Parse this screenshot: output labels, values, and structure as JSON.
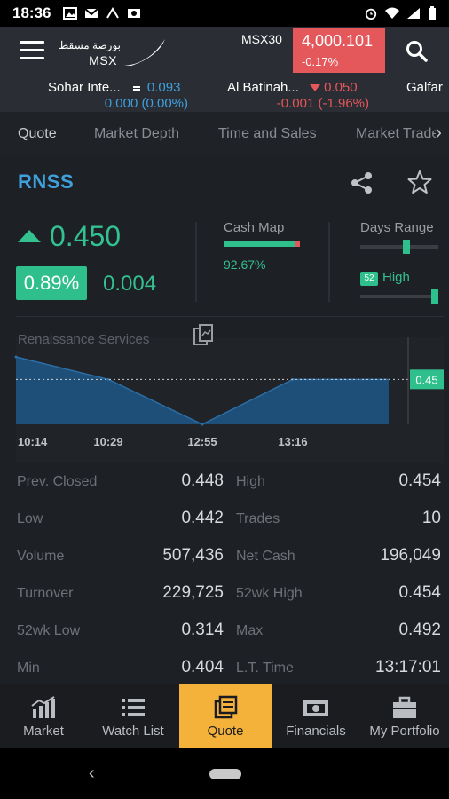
{
  "status_bar": {
    "time": "18:36"
  },
  "header": {
    "logo_arabic": "بورصة مسقط",
    "logo_text": "MSX",
    "index_name": "MSX30",
    "index_value": "4,000.101",
    "index_change": "-0.17%"
  },
  "ticker": [
    {
      "name": "Sohar Inte...",
      "value": "0.093",
      "direction": "unchanged",
      "change": "0.000 (0.00%)"
    },
    {
      "name": "Al Batinah...",
      "value": "0.050",
      "direction": "down",
      "change": "-0.001 (-1.96%)"
    },
    {
      "name": "Galfar",
      "value": "",
      "direction": "",
      "change": ""
    }
  ],
  "tabs": [
    "Quote",
    "Market Depth",
    "Time and Sales",
    "Market Trade"
  ],
  "active_tab": "Quote",
  "quote": {
    "symbol": "RNSS",
    "price": "0.450",
    "change_pct": "0.89%",
    "change": "0.004",
    "cash_map_label": "Cash Map",
    "cash_map_pct": "92.67%",
    "cash_map_fraction": 0.9267,
    "days_range_label": "Days Range",
    "days_range_position": 0.6,
    "wk52_badge": "52",
    "wk52_label": "High",
    "wk52_position": 1.0
  },
  "chart_data": {
    "type": "area",
    "title": "Renaissance Services",
    "x": [
      "10:14",
      "10:29",
      "12:55",
      "13:16"
    ],
    "x_tick_labels": [
      "10:14",
      "10:29",
      "12:55",
      "13:16"
    ],
    "series": [
      {
        "values": [
          0.454,
          0.45,
          0.442,
          0.45
        ]
      }
    ],
    "reference_line": 0.45,
    "last_price_label": "0.45",
    "ylim": [
      0.442,
      0.454
    ]
  },
  "stats": [
    {
      "left_label": "Prev. Closed",
      "left_value": "0.448",
      "right_label": "High",
      "right_value": "0.454"
    },
    {
      "left_label": "Low",
      "left_value": "0.442",
      "right_label": "Trades",
      "right_value": "10"
    },
    {
      "left_label": "Volume",
      "left_value": "507,436",
      "right_label": "Net Cash",
      "right_value": "196,049"
    },
    {
      "left_label": "Turnover",
      "left_value": "229,725",
      "right_label": "52wk High",
      "right_value": "0.454"
    },
    {
      "left_label": "52wk Low",
      "left_value": "0.314",
      "right_label": "Max",
      "right_value": "0.492"
    },
    {
      "left_label": "Min",
      "left_value": "0.404",
      "right_label": "L.T. Time",
      "right_value": "13:17:01"
    }
  ],
  "bottom_nav": [
    {
      "label": "Market",
      "icon": "bar-chart-icon"
    },
    {
      "label": "Watch List",
      "icon": "list-icon"
    },
    {
      "label": "Quote",
      "icon": "quote-icon"
    },
    {
      "label": "Financials",
      "icon": "money-icon"
    },
    {
      "label": "My Portfolio",
      "icon": "briefcase-icon"
    }
  ],
  "active_nav": "Quote",
  "colors": {
    "up": "#33c18f",
    "down": "#e4575a",
    "accent": "#3fa0dc",
    "nav_active": "#f5b23a",
    "chart_fill": "#1e4f78"
  }
}
